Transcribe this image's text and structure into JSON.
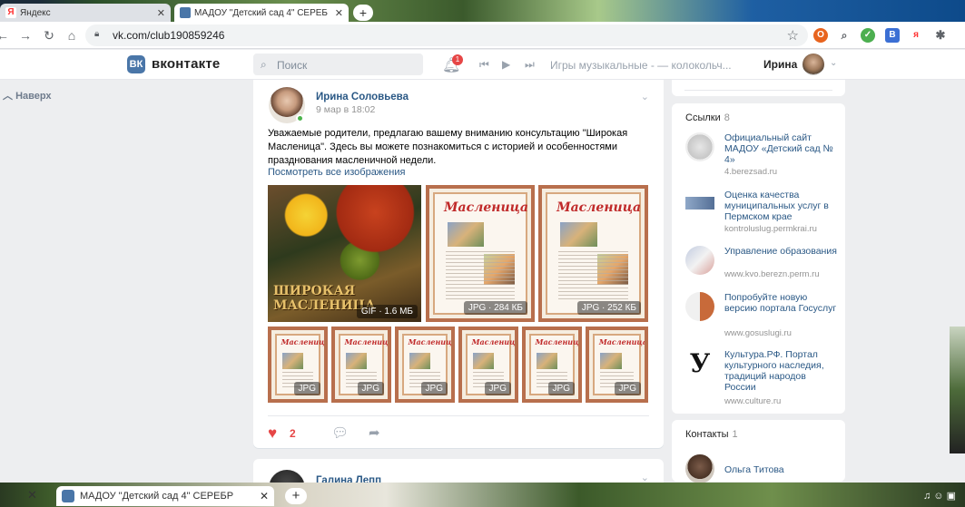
{
  "browser": {
    "tabs": [
      {
        "label": "Яндекс",
        "active": false
      },
      {
        "label": "МАДОУ \"Детский сад 4\" СЕРЕБ",
        "active": true
      }
    ],
    "url": "vk.com/club190859246"
  },
  "vk": {
    "logo_letters": "ВК",
    "brand": "вконтакте",
    "search_placeholder": "Поиск",
    "notifications": "1",
    "track": "Игры музыкальные - — колокольч...",
    "user_name": "Ирина",
    "back_label": "Наверх"
  },
  "post": {
    "author": "Ирина Соловьева",
    "date": "9 мар в 18:02",
    "text": "Уважаемые родители, предлагаю вашему вниманию консультацию \"Широкая Масленица\". Здесь вы можете познакомиться с историей и особенностями празднования масленичной недели.",
    "show_all": "Посмотреть все изображения",
    "big_images": [
      {
        "tag": "GIF · 1.6 МБ",
        "overlay": "ШИРОКАЯ МАСЛЕНИЦА"
      },
      {
        "tag": "JPG · 284 КБ",
        "heading": "Масленица"
      },
      {
        "tag": "JPG · 252 КБ",
        "heading": "Масленица"
      }
    ],
    "small_images": [
      {
        "tag": "JPG",
        "heading": "Масленица"
      },
      {
        "tag": "JPG",
        "heading": "Масленица"
      },
      {
        "tag": "JPG",
        "heading": "Масленица"
      },
      {
        "tag": "JPG",
        "heading": "Масленица"
      },
      {
        "tag": "JPG",
        "heading": "Масленица"
      },
      {
        "tag": "JPG",
        "heading": "Масленица"
      }
    ],
    "likes": "2"
  },
  "post2": {
    "author": "Галина Лепп"
  },
  "links": {
    "title": "Ссылки",
    "count": "8",
    "items": [
      {
        "title": "Официальный сайт МАДОУ «Детский сад № 4»",
        "url": "4.berezsad.ru"
      },
      {
        "title": "Оценка качества муниципальных услуг в Пермском крае",
        "url": "kontroluslug.permkrai.ru"
      },
      {
        "title": "Управление образования",
        "url": "www.kvo.berezn.perm.ru"
      },
      {
        "title": "Попробуйте новую версию портала Госуслуг",
        "url": "www.gosuslugi.ru"
      },
      {
        "title": "Культура.РФ. Портал культурного наследия, традиций народов России",
        "url": "www.culture.ru"
      }
    ]
  },
  "contacts": {
    "title": "Контакты",
    "count": "1",
    "items": [
      {
        "name": "Ольга Титова"
      }
    ]
  },
  "taskbar": {
    "tab_label": "МАДОУ \"Детский сад 4\" СЕРЕБР"
  },
  "colors": {
    "vk_blue": "#4a76a8",
    "link": "#2a5885",
    "like_red": "#e64646",
    "page_bg": "#edeef0"
  }
}
